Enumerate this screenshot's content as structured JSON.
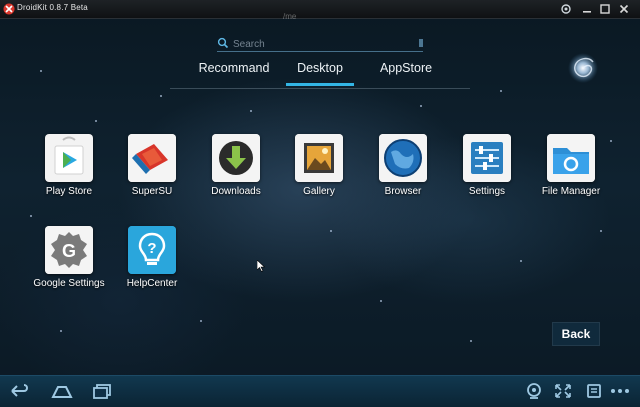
{
  "window": {
    "title": "DroidKit 0.8.7 Beta",
    "controls": [
      "settings-icon",
      "minimize-icon",
      "maximize-icon",
      "close-icon"
    ]
  },
  "status": {
    "mark": "/me"
  },
  "search": {
    "placeholder": "Search"
  },
  "tabs": [
    {
      "label": "Recommand",
      "selected": false
    },
    {
      "label": "Desktop",
      "selected": true
    },
    {
      "label": "AppStore",
      "selected": false
    }
  ],
  "apps": [
    {
      "label": "Play Store",
      "icon": "play-store-icon"
    },
    {
      "label": "SuperSU",
      "icon": "supersu-icon"
    },
    {
      "label": "Downloads",
      "icon": "downloads-icon"
    },
    {
      "label": "Gallery",
      "icon": "gallery-icon"
    },
    {
      "label": "Browser",
      "icon": "browser-icon"
    },
    {
      "label": "Settings",
      "icon": "settings-icon"
    },
    {
      "label": "File Manager",
      "icon": "file-manager-icon"
    },
    {
      "label": "Google Settings",
      "icon": "google-settings-icon"
    },
    {
      "label": "HelpCenter",
      "icon": "helpcenter-icon"
    }
  ],
  "back_button": {
    "label": "Back"
  },
  "navbar": {
    "left": [
      "back-icon",
      "home-icon",
      "recent-apps-icon"
    ],
    "right": [
      "camera-icon",
      "fullscreen-icon",
      "rotate-icon",
      "more-icon"
    ]
  },
  "colors": {
    "accent": "#33b5e5",
    "navbar": "#0f3047",
    "background": "#0b1a26"
  }
}
